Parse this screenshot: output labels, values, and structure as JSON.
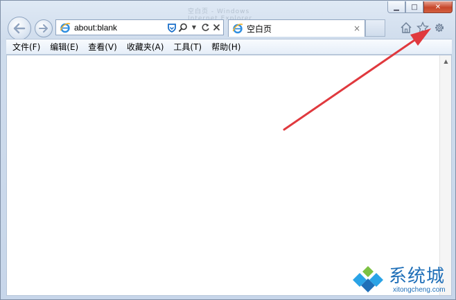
{
  "window": {
    "caption": "空白页 - Windows Internet Explorer",
    "controls": {
      "minimize": "▁",
      "maximize": "□",
      "close": "✕"
    }
  },
  "nav": {
    "back_icon": "back-arrow-icon",
    "forward_icon": "forward-arrow-icon"
  },
  "address_bar": {
    "value": "about:blank",
    "icons": [
      "ie-logo-icon",
      "shield-icon",
      "search-icon",
      "dropdown-icon",
      "refresh-icon",
      "stop-icon"
    ]
  },
  "tab": {
    "title": "空白页",
    "close": "×"
  },
  "toolbar_icons": [
    "home-icon",
    "favorites-star-icon",
    "gear-icon"
  ],
  "menu": {
    "items": [
      {
        "label": "文件(F)"
      },
      {
        "label": "编辑(E)"
      },
      {
        "label": "查看(V)"
      },
      {
        "label": "收藏夹(A)"
      },
      {
        "label": "工具(T)"
      },
      {
        "label": "帮助(H)"
      }
    ]
  },
  "watermark": {
    "title": "系统城",
    "url": "xitongcheng.com"
  },
  "colors": {
    "annotation_arrow": "#e0393e",
    "watermark": "#1f6fb8"
  }
}
